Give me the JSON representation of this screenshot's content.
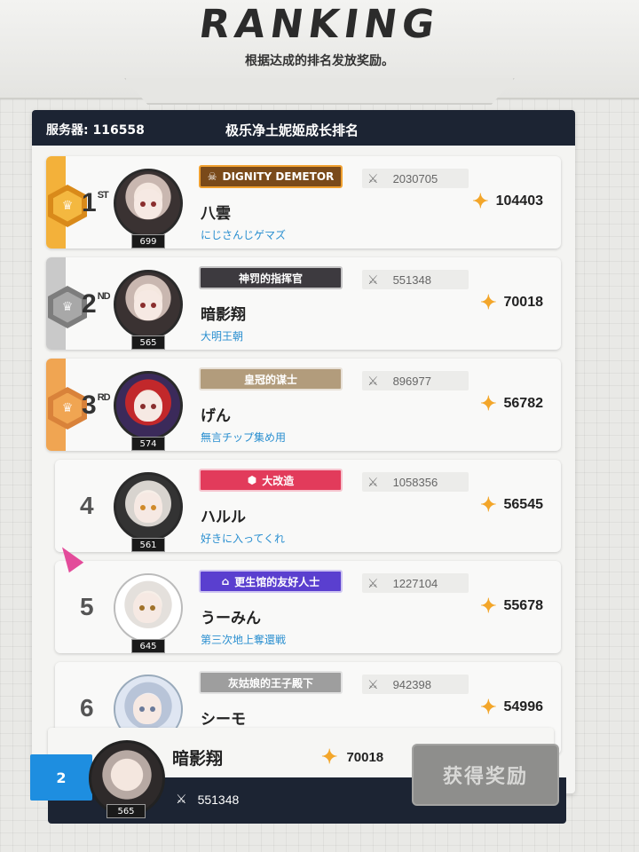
{
  "header": {
    "title": "RANKING",
    "subtitle": "根据达成的排名发放奖励。"
  },
  "board": {
    "server_label": "服务器: 116558",
    "title": "极乐净土妮姬成长排名"
  },
  "entries": [
    {
      "rank": "1",
      "suffix": "ST",
      "level": "699",
      "badge": "DIGNITY DEMETOR",
      "power": "2030705",
      "name": "八雲",
      "guild": "にじさんじゲマズ",
      "score": "104403",
      "medal": "gold"
    },
    {
      "rank": "2",
      "suffix": "ND",
      "level": "565",
      "badge": "神罚的指挥官",
      "power": "551348",
      "name": "暗影翔",
      "guild": "大明王朝",
      "score": "70018",
      "medal": "silver"
    },
    {
      "rank": "3",
      "suffix": "RD",
      "level": "574",
      "badge": "皇冠的谋士",
      "power": "896977",
      "name": "げん",
      "guild": "無言チップ集め用",
      "score": "56782",
      "medal": "bronze"
    },
    {
      "rank": "4",
      "suffix": "",
      "level": "561",
      "badge": "大改造",
      "power": "1058356",
      "name": "ハルル",
      "guild": "好きに入ってくれ",
      "score": "56545",
      "medal": "none"
    },
    {
      "rank": "5",
      "suffix": "",
      "level": "645",
      "badge": "更生馆的友好人士",
      "power": "1227104",
      "name": "うーみん",
      "guild": "第三次地上奪還戦",
      "score": "55678",
      "medal": "none"
    },
    {
      "rank": "6",
      "suffix": "",
      "level": "",
      "badge": "灰姑娘的王子殿下",
      "power": "942398",
      "name": "シーモ",
      "guild": "",
      "score": "54996",
      "medal": "none"
    }
  ],
  "me": {
    "rank": "2",
    "level": "565",
    "name": "暗影翔",
    "score": "70018",
    "power": "551348",
    "claim_label": "获得奖励"
  },
  "colors": {
    "gold": "#f3b13a",
    "silver": "#9b9b9b",
    "bronze": "#f0a552",
    "header_bg": "#1c2433",
    "my_rank_bg": "#1e8ee0",
    "guild_text": "#2a8fd0",
    "badge_dignity": "#7a4a1a",
    "badge_punish": "#3d3a3f",
    "badge_crown": "#b29c7c",
    "badge_remodel": "#e23b5b",
    "badge_friendly": "#5a3fcf",
    "badge_prince": "#9e9e9e"
  },
  "icons": {
    "star": "star-icon",
    "power": "crossed-swords-icon",
    "cursor": "mouse-cursor-icon"
  }
}
